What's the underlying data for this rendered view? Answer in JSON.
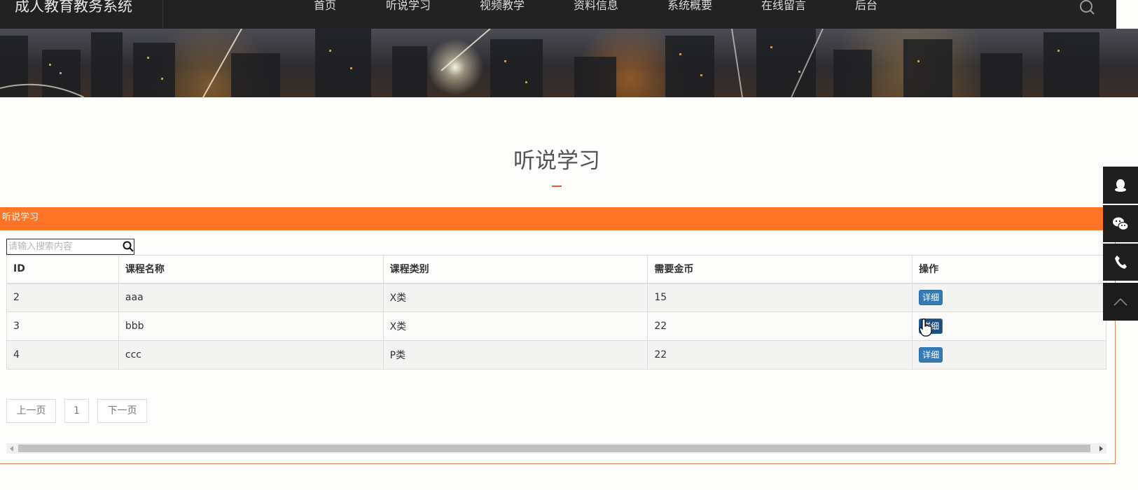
{
  "header": {
    "site_title": "成人教育教务系统",
    "nav": [
      "首页",
      "听说学习",
      "视频教学",
      "资料信息",
      "系统概要",
      "在线留言",
      "后台"
    ]
  },
  "section": {
    "title": "听说学习",
    "panel_title": "听说学习"
  },
  "search": {
    "placeholder": "请输入搜索内容",
    "value": ""
  },
  "table": {
    "headers": [
      "ID",
      "课程名称",
      "课程类别",
      "需要金币",
      "操作"
    ],
    "rows": [
      {
        "id": "2",
        "name": "aaa",
        "category": "X类",
        "coins": "15",
        "action": "详细"
      },
      {
        "id": "3",
        "name": "bbb",
        "category": "X类",
        "coins": "22",
        "action": "详细"
      },
      {
        "id": "4",
        "name": "ccc",
        "category": "P类",
        "coins": "22",
        "action": "详细"
      }
    ]
  },
  "pagination": {
    "prev": "上一页",
    "current": "1",
    "next": "下一页"
  },
  "colors": {
    "accent": "#ff7425",
    "topbar": "#222222",
    "button": "#337ab7"
  },
  "side_tools": [
    "qq-icon",
    "wechat-icon",
    "phone-icon",
    "back-to-top-icon"
  ]
}
